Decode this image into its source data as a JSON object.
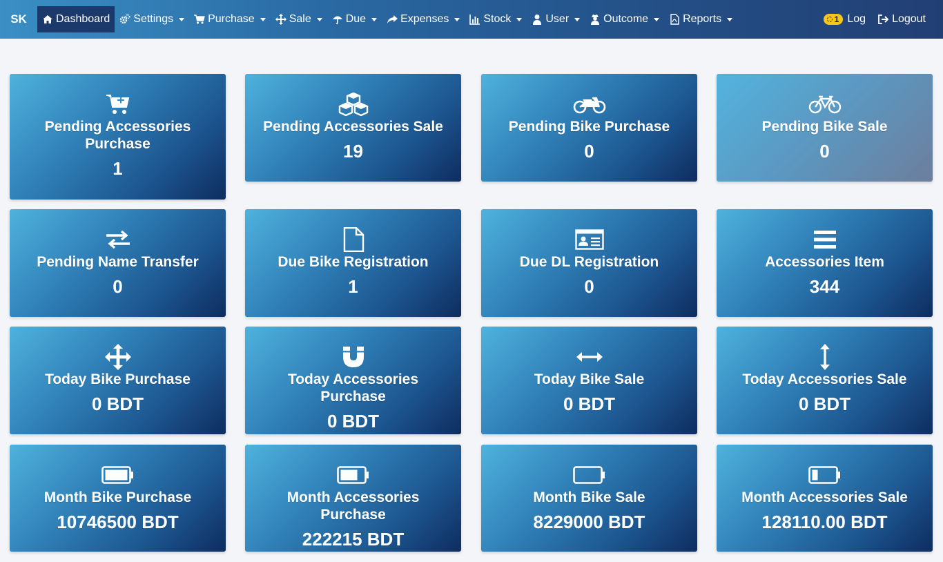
{
  "brand": "SK",
  "nav": [
    {
      "label": "Dashboard",
      "icon": "home-icon"
    },
    {
      "label": "Settings",
      "icon": "gears-icon"
    },
    {
      "label": "Purchase",
      "icon": "cart-icon"
    },
    {
      "label": "Sale",
      "icon": "move-icon"
    },
    {
      "label": "Due",
      "icon": "umbrella-icon"
    },
    {
      "label": "Expenses",
      "icon": "share-icon"
    },
    {
      "label": "Stock",
      "icon": "bar-chart-icon"
    },
    {
      "label": "User",
      "icon": "user-icon"
    },
    {
      "label": "Outcome",
      "icon": "user-secret-icon"
    },
    {
      "label": "Reports",
      "icon": "file-pdf-icon"
    }
  ],
  "right": {
    "badge": "1",
    "log": "Log",
    "logout": "Logout"
  },
  "cards": [
    {
      "title": "Pending Accessories Purchase",
      "value": "1",
      "icon": "cart-plus-icon"
    },
    {
      "title": "Pending Accessories Sale",
      "value": "19",
      "icon": "cubes-icon"
    },
    {
      "title": "Pending Bike Purchase",
      "value": "0",
      "icon": "motorcycle-icon"
    },
    {
      "title": "Pending Bike Sale",
      "value": "0",
      "icon": "bicycle-icon"
    },
    {
      "title": "Pending Name Transfer",
      "value": "0",
      "icon": "exchange-icon"
    },
    {
      "title": "Due Bike Registration",
      "value": "1",
      "icon": "file-icon"
    },
    {
      "title": "Due DL Registration",
      "value": "0",
      "icon": "id-card-icon"
    },
    {
      "title": "Accessories Item",
      "value": "344",
      "icon": "bars-icon"
    },
    {
      "title": "Today Bike Purchase",
      "value": "0 BDT",
      "icon": "arrows-icon"
    },
    {
      "title": "Today Accessories Purchase",
      "value": "0 BDT",
      "icon": "magnet-icon"
    },
    {
      "title": "Today Bike Sale",
      "value": "0 BDT",
      "icon": "arrows-h-icon"
    },
    {
      "title": "Today Accessories Sale",
      "value": "0 BDT",
      "icon": "arrows-v-icon"
    },
    {
      "title": "Month Bike Purchase",
      "value": "10746500 BDT",
      "icon": "battery-full-icon",
      "battery_level": 1.0
    },
    {
      "title": "Month Accessories Purchase",
      "value": "222215 BDT",
      "icon": "battery-three-quarters-icon",
      "battery_level": 0.75
    },
    {
      "title": "Month Bike Sale",
      "value": "8229000 BDT",
      "icon": "battery-empty-icon",
      "battery_level": 0
    },
    {
      "title": "Month Accessories Sale",
      "value": "128110.00 BDT",
      "icon": "battery-quarter-icon",
      "battery_level": 0.25
    }
  ]
}
